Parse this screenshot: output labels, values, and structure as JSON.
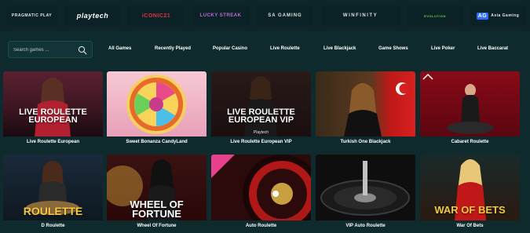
{
  "providers": [
    {
      "label": "PRAGMATIC PLAY"
    },
    {
      "label": "playtech"
    },
    {
      "label": "iCONIC21"
    },
    {
      "label": "LUCKY STREAK"
    },
    {
      "label": "SA GAMING"
    },
    {
      "label": "WINFINITY"
    },
    {
      "label": "EVOLUTION"
    },
    {
      "label": "Asia Gaming",
      "badge": "AG"
    }
  ],
  "search": {
    "placeholder": "Search games ..."
  },
  "categories": [
    "All Games",
    "Recently Played",
    "Popular Casino",
    "Live Roulette",
    "Live Blackjack",
    "Game Shows",
    "Live Poker",
    "Live Baccarat"
  ],
  "games": [
    {
      "title": "Live Roulette European",
      "overlay": "LIVE ROULETTE EUROPEAN",
      "overlay_sub": ""
    },
    {
      "title": "Sweet Bonanza CandyLand",
      "overlay": "",
      "overlay_sub": ""
    },
    {
      "title": "Live Roulette European VIP",
      "overlay": "LIVE ROULETTE EUROPEAN VIP",
      "overlay_sub": "Playtech"
    },
    {
      "title": "Turkish One Blackjack",
      "overlay": "",
      "overlay_sub": ""
    },
    {
      "title": "Cabaret Roulette",
      "overlay": "",
      "overlay_sub": ""
    },
    {
      "title": "D Roulette",
      "overlay": "ROULETTE",
      "overlay_sub": ""
    },
    {
      "title": "Wheel Of Fortune",
      "overlay": "WHEEL OF FORTUNE",
      "overlay_sub": ""
    },
    {
      "title": "Auto Roulette",
      "overlay": "",
      "overlay_sub": ""
    },
    {
      "title": "VIP Auto Roulette",
      "overlay": "",
      "overlay_sub": ""
    },
    {
      "title": "War Of Bets",
      "overlay": "WAR OF BETS",
      "overlay_sub": ""
    }
  ],
  "colors": {
    "background": "#0f2a2d",
    "header": "#0d2528",
    "accent": "#2d6cff"
  }
}
